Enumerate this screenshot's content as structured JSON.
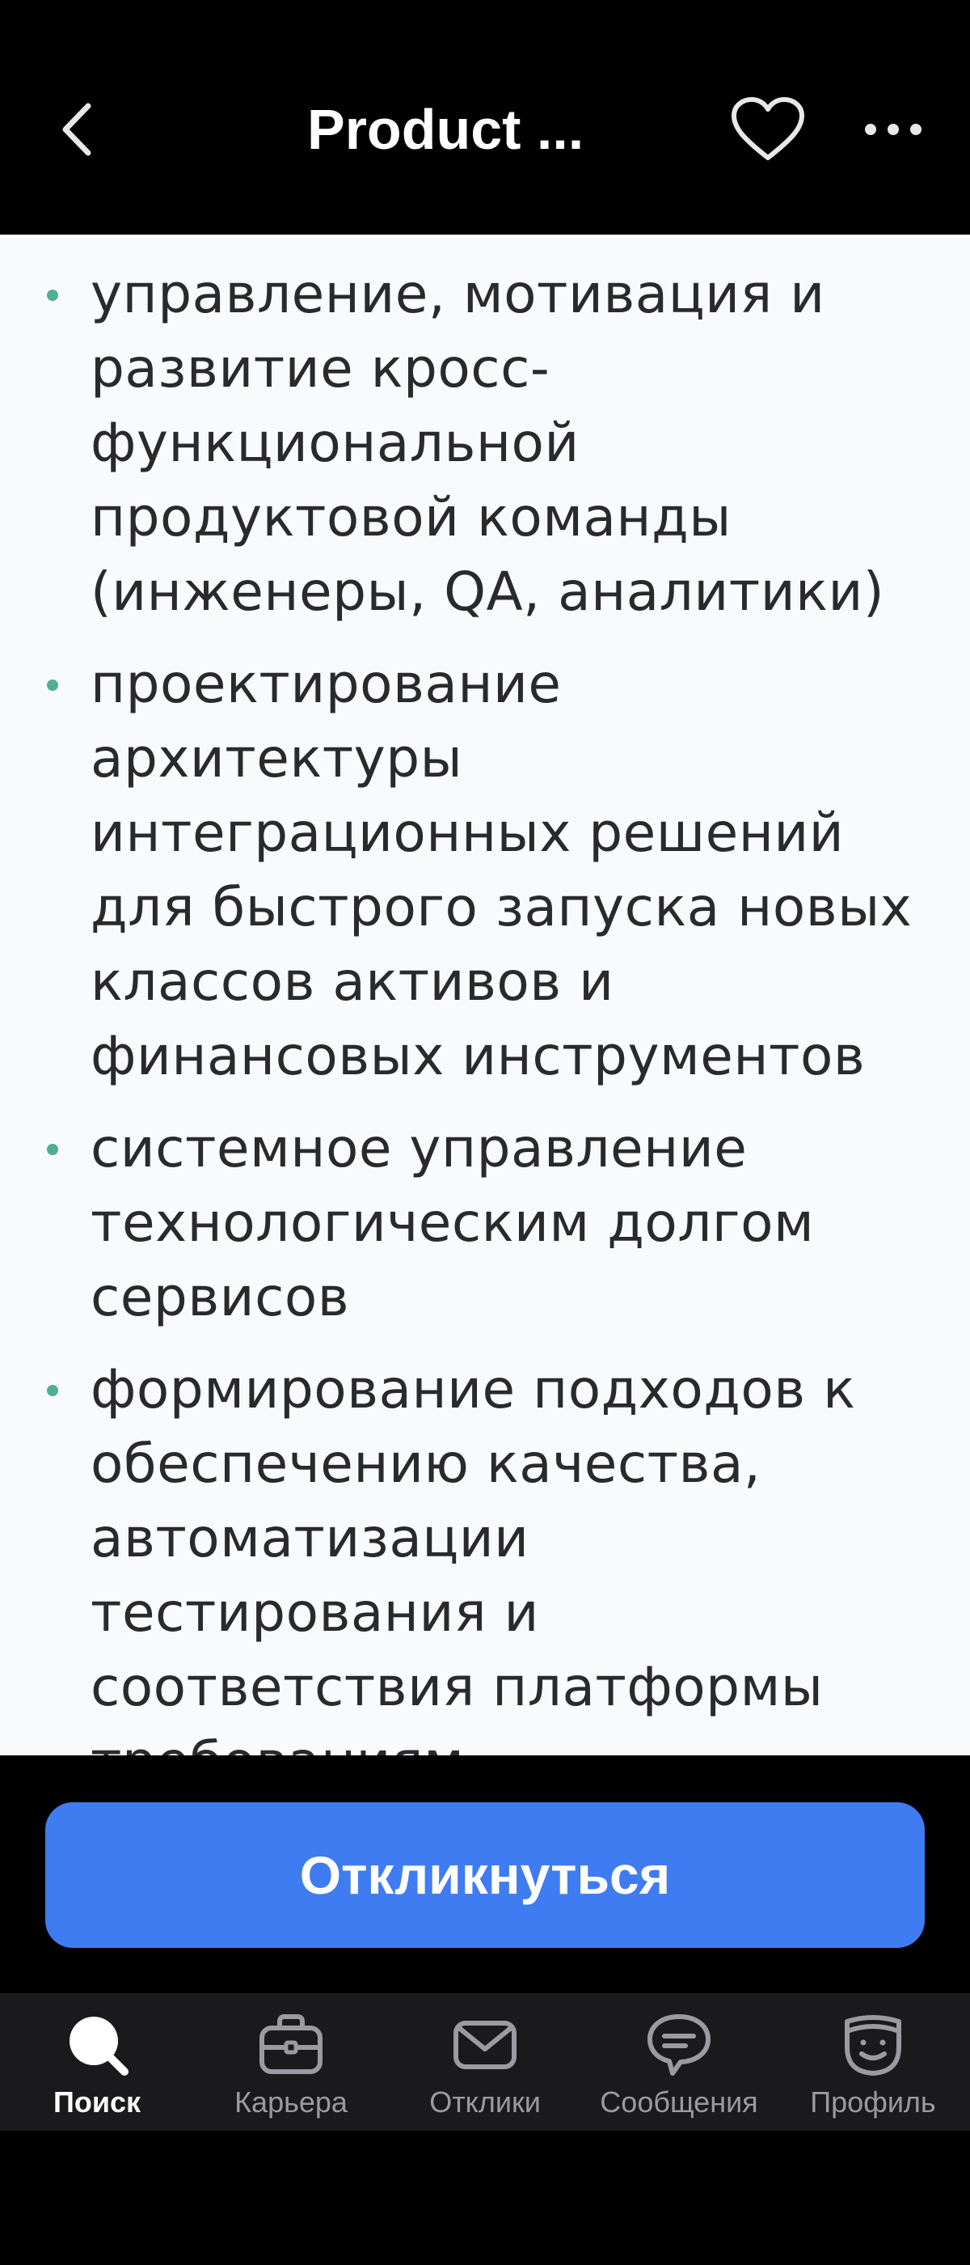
{
  "header": {
    "title": "Product ...",
    "back_icon": "chevron-left-icon",
    "favorite_icon": "heart-icon",
    "more_icon": "more-dots-icon"
  },
  "content": {
    "bullet_color": "#4fae95",
    "items": [
      {
        "text": "управление, мотивация и развитие кросс-функциональной продуктовой команды (инженеры, QA, аналитики)"
      },
      {
        "text": "проектирование архитектуры интеграционных решений для быстрого запуска новых классов активов и финансовых инструментов"
      },
      {
        "text": "системное управление технологическим долгом сервисов"
      },
      {
        "text": "формирование подходов к обеспечению качества, автоматизации тестирования и соответствия платформы требованиям"
      }
    ]
  },
  "action": {
    "respond_label": "Откликнуться",
    "respond_color": "#3f7cf2"
  },
  "tabbar": {
    "tabs": [
      {
        "label": "Поиск",
        "icon": "search-icon",
        "active": true
      },
      {
        "label": "Карьера",
        "icon": "briefcase-icon",
        "active": false
      },
      {
        "label": "Отклики",
        "icon": "envelope-icon",
        "active": false
      },
      {
        "label": "Сообщения",
        "icon": "chat-bubble-icon",
        "active": false
      },
      {
        "label": "Профиль",
        "icon": "profile-mask-icon",
        "active": false
      }
    ]
  }
}
